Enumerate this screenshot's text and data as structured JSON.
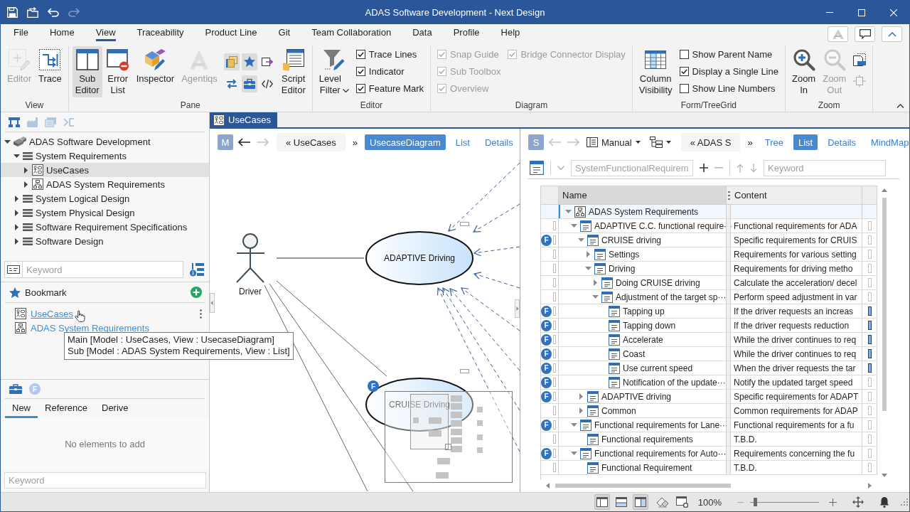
{
  "window": {
    "title": "ADAS Software Development - Next Design"
  },
  "menu_tabs": [
    {
      "label": "File",
      "selected": false
    },
    {
      "label": "Home",
      "selected": false
    },
    {
      "label": "View",
      "selected": true
    },
    {
      "label": "Traceability",
      "selected": false
    },
    {
      "label": "Product Line",
      "selected": false
    },
    {
      "label": "Git",
      "selected": false
    },
    {
      "label": "Team Collaboration",
      "selected": false
    },
    {
      "label": "Data",
      "selected": false
    },
    {
      "label": "Profile",
      "selected": false
    },
    {
      "label": "Help",
      "selected": false
    }
  ],
  "ribbon_groups": [
    {
      "label": "View",
      "items": [
        {
          "kind": "large",
          "label": "Editor",
          "disabled": true,
          "selected": false
        },
        {
          "kind": "large",
          "label": "Trace",
          "disabled": false,
          "selected": false
        }
      ]
    },
    {
      "label": "Pane",
      "items": [
        {
          "kind": "large",
          "label": "Sub Editor",
          "disabled": false,
          "selected": true
        },
        {
          "kind": "large",
          "label": "Error List",
          "disabled": false,
          "selected": false
        },
        {
          "kind": "large",
          "label": "Inspector",
          "disabled": false,
          "selected": false
        },
        {
          "kind": "large",
          "label": "Agentiqs",
          "disabled": true,
          "selected": false
        },
        {
          "kind": "tool_grid",
          "tools": [
            {
              "selected": true
            },
            {
              "selected": true
            },
            {
              "selected": false
            },
            {
              "selected": false
            },
            {
              "selected": true
            },
            {
              "selected": false
            }
          ]
        },
        {
          "kind": "large",
          "label": "Script Editor",
          "disabled": false,
          "selected": false
        }
      ]
    },
    {
      "label": "Editor",
      "items": [
        {
          "kind": "dropdown",
          "label": "Level Filter"
        },
        {
          "kind": "checks",
          "checks": [
            {
              "label": "Trace Lines",
              "checked": true,
              "disabled": false
            },
            {
              "label": "Indicator",
              "checked": true,
              "disabled": false
            },
            {
              "label": "Feature Mark",
              "checked": true,
              "disabled": false
            }
          ]
        }
      ]
    },
    {
      "label": "Diagram",
      "items": [
        {
          "kind": "checks",
          "checks": [
            {
              "label": "Snap Guide",
              "checked": true,
              "disabled": true
            },
            {
              "label": "Sub Toolbox",
              "checked": true,
              "disabled": true
            },
            {
              "label": "Overview",
              "checked": true,
              "disabled": true
            }
          ]
        },
        {
          "kind": "checks",
          "checks": [
            {
              "label": "Bridge Connector Display",
              "checked": true,
              "disabled": true
            }
          ]
        }
      ]
    },
    {
      "label": "Form/TreeGrid",
      "items": [
        {
          "kind": "large",
          "label": "Column Visibility",
          "disabled": false,
          "selected": false
        },
        {
          "kind": "checks",
          "checks": [
            {
              "label": "Show Parent Name",
              "checked": false,
              "disabled": false
            },
            {
              "label": "Display a Single Line",
              "checked": true,
              "disabled": false
            },
            {
              "label": "Show Line Numbers",
              "checked": false,
              "disabled": false
            }
          ]
        }
      ]
    },
    {
      "label": "Zoom",
      "items": [
        {
          "kind": "large",
          "label": "Zoom In",
          "disabled": false,
          "selected": false
        },
        {
          "kind": "large",
          "label": "Zoom Out",
          "disabled": true,
          "selected": false
        },
        {
          "kind": "tool_stack",
          "tools": [
            {
              "disabled": false
            },
            {
              "disabled": true
            }
          ]
        }
      ]
    }
  ],
  "explorer": {
    "tree": [
      {
        "kind": "project",
        "label": "ADAS Software Development",
        "expanded": true,
        "selected": false,
        "children": [
          {
            "kind": "package",
            "label": "System Requirements",
            "expanded": true,
            "selected": false,
            "children": [
              {
                "kind": "usecase",
                "label": "UseCases",
                "expanded": false,
                "selected": true
              },
              {
                "kind": "structure",
                "label": "ADAS System Requirements",
                "expanded": false,
                "selected": false
              }
            ]
          },
          {
            "kind": "package",
            "label": "System Logical Design",
            "expanded": false,
            "selected": false
          },
          {
            "kind": "package",
            "label": "System Physical Design",
            "expanded": false,
            "selected": false
          },
          {
            "kind": "package",
            "label": "Software Requirement Specifications",
            "expanded": false,
            "selected": false
          },
          {
            "kind": "package",
            "label": "Software Design",
            "expanded": false,
            "selected": false
          }
        ]
      }
    ],
    "search": {
      "placeholder": "Keyword"
    }
  },
  "bookmarks": {
    "title": "Bookmark",
    "items": [
      {
        "kind": "usecase",
        "label": "UseCases",
        "hovered": true
      },
      {
        "kind": "structure",
        "label": "ADAS System Requirements",
        "hovered": false
      }
    ],
    "tooltip": {
      "lines": [
        "Main [Model : UseCases, View : UsecaseDiagram]",
        "Sub [Model : ADAS System Requirements, View : List]"
      ]
    }
  },
  "toolbox": {
    "feature_badge": "F",
    "tabs": [
      {
        "label": "New",
        "selected": true
      },
      {
        "label": "Reference",
        "selected": false
      },
      {
        "label": "Derive",
        "selected": false
      }
    ],
    "empty_message": "No elements to add",
    "search": {
      "placeholder": "Keyword"
    }
  },
  "document_tabs": [
    {
      "label": "UseCases",
      "selected": true
    }
  ],
  "main_editor": {
    "badge": "M",
    "back_disabled": false,
    "forward_disabled": true,
    "breadcrumb": "« UseCases",
    "overflow": "»",
    "views": [
      {
        "label": "UsecaseDiagram",
        "selected": true
      },
      {
        "label": "List",
        "selected": false
      },
      {
        "label": "Details",
        "selected": false
      }
    ],
    "diagram": {
      "actor": {
        "label": "Driver"
      },
      "use_cases": [
        {
          "label": "ADAPTIVE Driving"
        },
        {
          "label": "CRUISE Driving",
          "feature_mark": "F"
        }
      ]
    }
  },
  "sub_editor": {
    "badge": "S",
    "back_disabled": true,
    "forward_disabled": true,
    "layout_menu": "Manual",
    "breadcrumb": "« ADAS S",
    "overflow": "»",
    "views": [
      {
        "label": "Tree",
        "selected": false
      },
      {
        "label": "List",
        "selected": true
      },
      {
        "label": "Details",
        "selected": false
      },
      {
        "label": "MindMap",
        "selected": false
      }
    ],
    "model_field": {
      "value": "SystemFunctionalRequirem",
      "disabled": true
    },
    "tools": [
      {
        "kind": "add",
        "disabled": false
      },
      {
        "kind": "remove",
        "disabled": true
      },
      {
        "kind": "up",
        "disabled": true
      },
      {
        "kind": "down",
        "disabled": true
      }
    ],
    "search": {
      "placeholder": "Keyword"
    },
    "grid": {
      "columns": [
        {
          "label": "Name",
          "selected": true
        },
        {
          "label": "Content",
          "selected": false
        }
      ],
      "rows": [
        {
          "name": "ADAS System Requirements",
          "selected": true,
          "expanded": true,
          "children": [
            {
              "name": "ADAPTIVE C.C. functional require···",
              "content": "Functional requirements for ADA",
              "selected": false,
              "expanded": true,
              "column_3_marked": false,
              "children": [
                {
                  "name": "CRUISE driving",
                  "feature_mark": "F",
                  "content": "Specific requirements for CRUIS",
                  "selected": false,
                  "expanded": true,
                  "column_3_marked": false,
                  "children": [
                    {
                      "name": "Settings",
                      "content": "Requirements for various setting",
                      "selected": false,
                      "expanded": false,
                      "column_3_marked": false
                    },
                    {
                      "name": "Driving",
                      "content": "Requirements for driving metho",
                      "selected": false,
                      "expanded": true,
                      "column_3_marked": false,
                      "children": [
                        {
                          "name": "Doing CRUISE driving",
                          "content": "Calculate the acceleration/ decel",
                          "selected": false,
                          "expanded": false,
                          "column_3_marked": false
                        },
                        {
                          "name": "Adjustment of the target sp···",
                          "content": "Perform speed adjustment in var",
                          "selected": false,
                          "expanded": true,
                          "column_3_marked": false,
                          "children": [
                            {
                              "name": "Tapping up",
                              "feature_mark": "F",
                              "content": "If the driver requests an increas",
                              "selected": false,
                              "column_3_marked": true
                            },
                            {
                              "name": "Tapping down",
                              "feature_mark": "F",
                              "content": "If the driver requests reduction",
                              "selected": false,
                              "column_3_marked": true
                            },
                            {
                              "name": "Accelerate",
                              "feature_mark": "F",
                              "content": "While the driver continues to req",
                              "selected": false,
                              "column_3_marked": true
                            },
                            {
                              "name": "Coast",
                              "feature_mark": "F",
                              "content": "While the driver continues to req",
                              "selected": false,
                              "column_3_marked": true
                            },
                            {
                              "name": "Use current speed",
                              "feature_mark": "F",
                              "content": "When the driver requests the tar",
                              "selected": false,
                              "column_3_marked": true
                            },
                            {
                              "name": "Notification of the update···",
                              "feature_mark": "F",
                              "content": "Notify the updated target speed",
                              "selected": false,
                              "column_3_marked": false
                            }
                          ]
                        }
                      ]
                    }
                  ]
                },
                {
                  "name": "ADAPTIVE driving",
                  "feature_mark": "F",
                  "content": "Specific requirements for ADAPT",
                  "selected": false,
                  "expanded": false,
                  "column_3_marked": false
                },
                {
                  "name": "Common",
                  "content": "Common requirements for ADAP",
                  "selected": false,
                  "expanded": false,
                  "column_3_marked": false
                }
              ]
            },
            {
              "name": "Functional requirements for Lane···",
              "feature_mark": "F",
              "content": "Functional requirements for a fu",
              "selected": false,
              "expanded": true,
              "column_3_marked": false,
              "children": [
                {
                  "name": "Functional requirements",
                  "content": "T.B.D.",
                  "selected": false,
                  "column_3_marked": false
                }
              ]
            },
            {
              "name": "Functional requirements for Auto···",
              "feature_mark": "F",
              "content": "Requirements concerning the fu",
              "selected": false,
              "expanded": true,
              "column_3_marked": false,
              "children": [
                {
                  "name": "Functional Requirement",
                  "content": "T.B.D.",
                  "selected": false,
                  "column_3_marked": false
                }
              ]
            }
          ]
        }
      ]
    }
  },
  "status_bar": {
    "layout_buttons": [
      {
        "selected": true
      },
      {
        "selected": false
      },
      {
        "selected": true
      }
    ],
    "zoom": {
      "reading": "100%",
      "level": 0.07
    }
  }
}
